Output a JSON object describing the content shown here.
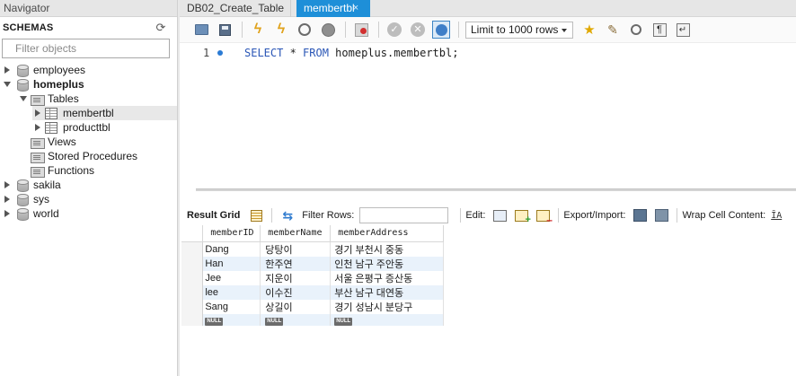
{
  "navigator": {
    "title": "Navigator",
    "schemas_label": "SCHEMAS",
    "filter_placeholder": "Filter objects",
    "tree": {
      "employees": "employees",
      "homeplus": "homeplus",
      "tables": "Tables",
      "membertbl": "membertbl",
      "producttbl": "producttbl",
      "views": "Views",
      "stored_procedures": "Stored Procedures",
      "functions": "Functions",
      "sakila": "sakila",
      "sys": "sys",
      "world": "world"
    }
  },
  "tabs": {
    "create_table": "DB02_Create_Table",
    "membertbl": "membertbl",
    "close_glyph": "×"
  },
  "toolbar": {
    "limit_rows": "Limit to 1000 rows"
  },
  "editor": {
    "line_number": "1",
    "sql": {
      "select": "SELECT",
      "star": " * ",
      "from": "FROM",
      "rest": " homeplus.membertbl;"
    }
  },
  "result_bar": {
    "result_grid": "Result Grid",
    "filter_rows": "Filter Rows:",
    "edit": "Edit:",
    "export_import": "Export/Import:",
    "wrap_cell": "Wrap Cell Content:",
    "wrap_glyph": "ĪA"
  },
  "grid": {
    "columns": [
      "memberID",
      "memberName",
      "memberAddress"
    ],
    "rows": [
      [
        "Dang",
        "당탕이",
        "경기 부천시 중동"
      ],
      [
        "Han",
        "한주연",
        "인천 남구 주안동"
      ],
      [
        "Jee",
        "지운이",
        "서울 은평구 증산동"
      ],
      [
        "lee",
        "이수진",
        "부산 남구 대연동"
      ],
      [
        "Sang",
        "상길이",
        "경기 성남시 분당구"
      ]
    ],
    "null_label": "NULL"
  },
  "colors": {
    "active_tab": "#1e8fd8",
    "sql_keyword": "#2a56b6",
    "alt_row": "#e9f2fb"
  }
}
